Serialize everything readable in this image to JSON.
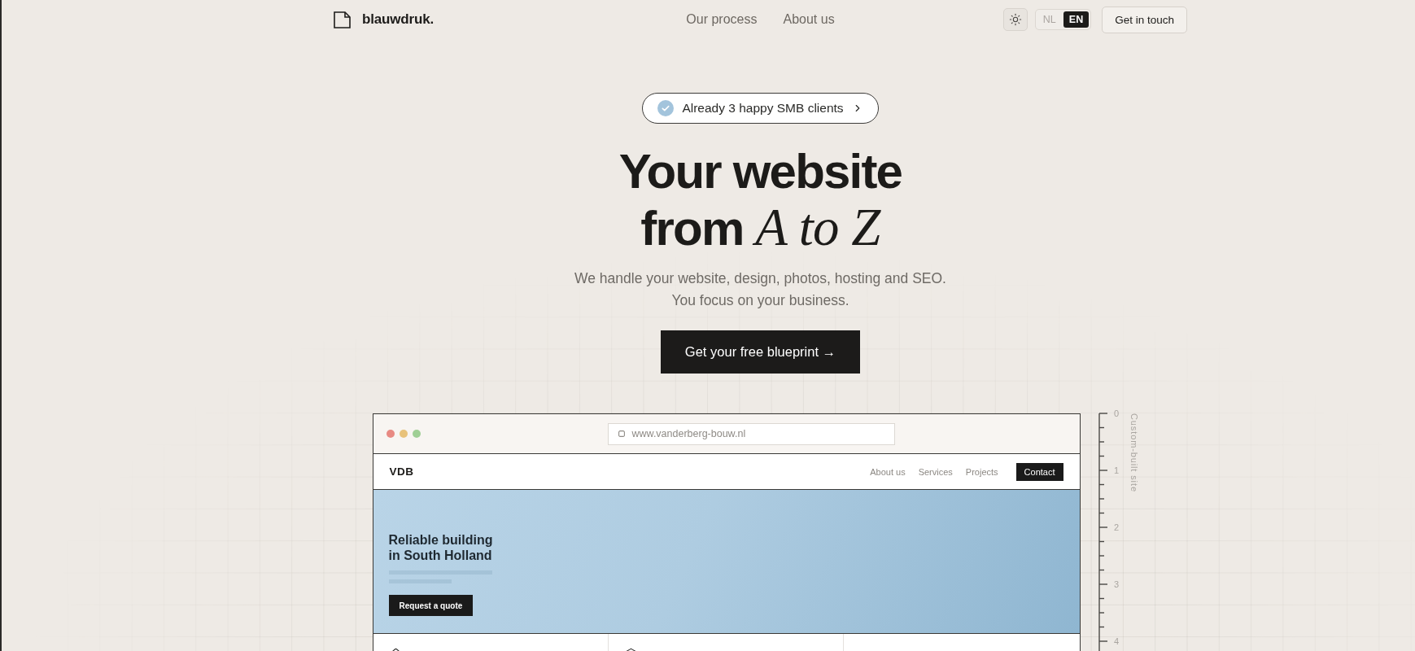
{
  "header": {
    "logo": "blauwdruk.",
    "nav": [
      {
        "label": "Our process"
      },
      {
        "label": "About us"
      }
    ],
    "languages": [
      {
        "label": "NL",
        "selected": false
      },
      {
        "label": "EN",
        "selected": true
      }
    ],
    "cta": "Get in touch"
  },
  "hero": {
    "badge": "Already 3 happy SMB clients",
    "title": [
      "Your website",
      "from *A to Z*"
    ],
    "subtitle": [
      "We handle your website, design, photos, hosting and SEO.",
      "You focus on your business."
    ],
    "cta": "Get your free blueprint →"
  },
  "mockup": {
    "url": "www.vanderberg-bouw.nl",
    "site_logo": "VDB",
    "site_nav": [
      {
        "label": "About us",
        "kind": "link"
      },
      {
        "label": "Services",
        "kind": "link"
      },
      {
        "label": "Projects",
        "kind": "link"
      },
      {
        "label": "Contact",
        "kind": "button"
      }
    ],
    "hero_title": [
      "Reliable building",
      "in South Holland"
    ],
    "hero_cta": "Request a quote"
  },
  "ruler": {
    "labels": [
      "0",
      "1",
      "2",
      "3",
      "4"
    ],
    "caption": "Custom-built site"
  }
}
